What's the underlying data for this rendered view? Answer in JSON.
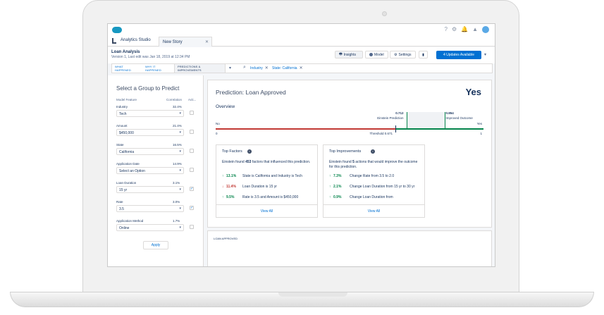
{
  "app": {
    "name": "Analytics Studio",
    "tab": "New Story"
  },
  "header": {
    "title": "Loan Analysis",
    "version": "Version 1, Last edit was Jan 18, 2019 at 12:34 PM",
    "buttons": {
      "insights": "Insights",
      "model": "Model",
      "settings": "Settings"
    },
    "updates": "4 Updates Available"
  },
  "filters": {
    "tabs": [
      "WHAT HAPPENED",
      "WHY IT HAPPENED",
      "PREDICTIONS & IMPROVEMENTS"
    ],
    "chips": [
      "Industry",
      "State: California"
    ]
  },
  "left_panel": {
    "title": "Select a Group to Predict",
    "columns": {
      "feature": "Model Feature",
      "correlation": "Correlation",
      "action": "Acti..."
    },
    "features": [
      {
        "name": "Industry",
        "correlation": "32.4%",
        "value": "Tech",
        "checked": false
      },
      {
        "name": "Amount",
        "correlation": "21.4%",
        "value": "$450,000",
        "checked": false
      },
      {
        "name": "State",
        "correlation": "16.5%",
        "value": "California",
        "checked": false
      },
      {
        "name": "Application Date",
        "correlation": "14.9%",
        "value": "Select an Option",
        "checked": false
      },
      {
        "name": "Loan Duration",
        "correlation": "3.1%",
        "value": "15 yr",
        "checked": true
      },
      {
        "name": "Rate",
        "correlation": "3.0%",
        "value": "3.5",
        "checked": true
      },
      {
        "name": "Application Method",
        "correlation": "1.7%",
        "value": "Online",
        "checked": false
      }
    ],
    "apply": "Apply"
  },
  "prediction": {
    "title": "Prediction: Loan Approved",
    "value": "Yes",
    "overview": "Overview",
    "no_label": "No",
    "yes_label": "Yes",
    "min": "0",
    "max": "1",
    "threshold_label": "Threshold 0.671",
    "einstein_value": "0.712",
    "einstein_label": "Einstein Prediction",
    "improved_value": "0.854",
    "improved_label": "Improved Outcome",
    "threshold": 0.671,
    "einstein": 0.712,
    "improved": 0.854
  },
  "top_factors": {
    "title": "Top Factors",
    "intro_pre": "Einstein found ",
    "count": "453",
    "intro_post": " factors that influenced this prediction.",
    "items": [
      {
        "arrow": "↑",
        "pct": "13.1%",
        "text": "State is California and Industry is Tech",
        "color": "#04844b"
      },
      {
        "arrow": "↓",
        "pct": "11.4%",
        "text": "Loan Duration is 15 yr",
        "color": "#c23934"
      },
      {
        "arrow": "↑",
        "pct": "9.5%",
        "text": "Rate is 3.5 and Amount is $450,000",
        "color": "#04844b"
      }
    ],
    "view_all": "View All"
  },
  "top_improvements": {
    "title": "Top Improvements",
    "intro_pre": "Einstein found ",
    "count": "5",
    "intro_post": " actions that would improve the outcome for this prediction.",
    "items": [
      {
        "arrow": "↑",
        "pct": "7.3%",
        "text": "Change  Rate from 3.5 to 2.0",
        "color": "#04844b"
      },
      {
        "arrow": "↑",
        "pct": "2.1%",
        "text": "Change  Loan Duration from 15 yr to 30 yr",
        "color": "#04844b"
      },
      {
        "arrow": "↑",
        "pct": "0.9%",
        "text": "Change  Loan Duration from",
        "color": "#04844b"
      }
    ],
    "view_all": "View All"
  },
  "bottom": {
    "label": "LOAN APPROVED"
  },
  "colors": {
    "accent": "#0070d2",
    "positive": "#04844b",
    "negative": "#c23934"
  }
}
